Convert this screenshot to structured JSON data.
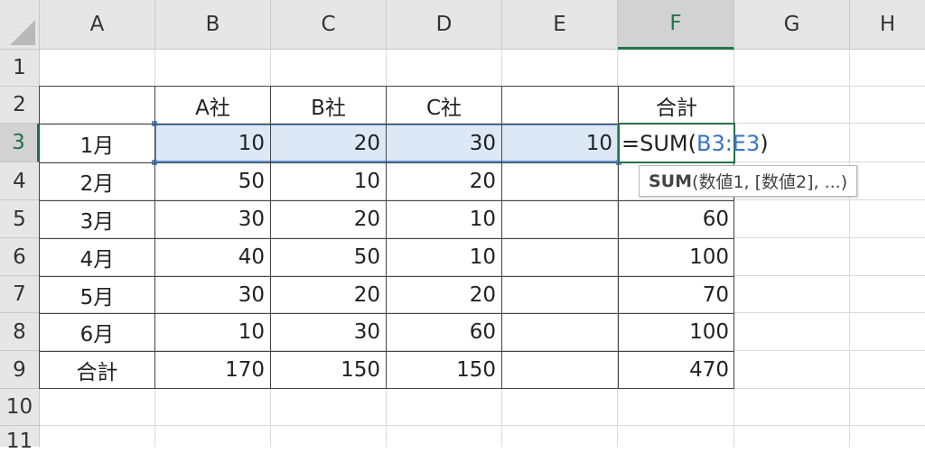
{
  "columns": [
    "A",
    "B",
    "C",
    "D",
    "E",
    "F",
    "G",
    "H"
  ],
  "rows": [
    "1",
    "2",
    "3",
    "4",
    "5",
    "6",
    "7",
    "8",
    "9",
    "10",
    "11"
  ],
  "header_row": [
    "",
    "A社",
    "B社",
    "C社",
    "",
    "合計"
  ],
  "data_rows": [
    {
      "label": "1月",
      "b": "10",
      "c": "20",
      "d": "30",
      "e": "10",
      "f": ""
    },
    {
      "label": "2月",
      "b": "50",
      "c": "10",
      "d": "20",
      "e": "",
      "f": ""
    },
    {
      "label": "3月",
      "b": "30",
      "c": "20",
      "d": "10",
      "e": "",
      "f": "60"
    },
    {
      "label": "4月",
      "b": "40",
      "c": "50",
      "d": "10",
      "e": "",
      "f": "100"
    },
    {
      "label": "5月",
      "b": "30",
      "c": "20",
      "d": "20",
      "e": "",
      "f": "70"
    },
    {
      "label": "6月",
      "b": "10",
      "c": "30",
      "d": "60",
      "e": "",
      "f": "100"
    },
    {
      "label": "合計",
      "b": "170",
      "c": "150",
      "d": "150",
      "e": "",
      "f": "470"
    }
  ],
  "formula": {
    "prefix": "=SUM(",
    "ref": "B3:E3",
    "suffix": ")"
  },
  "tooltip": {
    "fn": "SUM",
    "args": "(数値1, [数値2], ...)"
  },
  "colors": {
    "accent": "#217346",
    "selection": "#5b8fd6",
    "selection_fill": "#dde8f6",
    "ref": "#3a74c4"
  }
}
